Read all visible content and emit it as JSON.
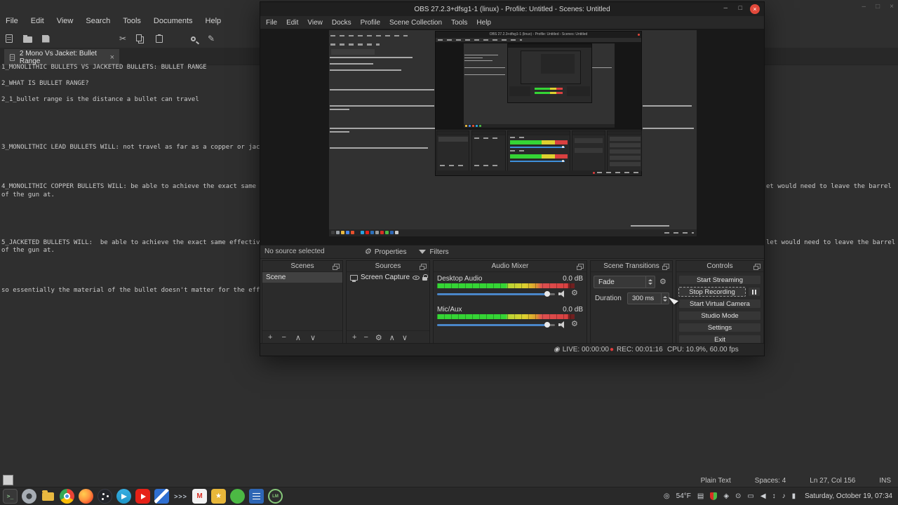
{
  "icons": {
    "close": "×",
    "minimize": "–",
    "maximize": "□",
    "plus": "+",
    "minus": "−",
    "chev_up": "∧",
    "chev_down": "∨",
    "gear": "⚙",
    "live": "◉",
    "record_dot": "●",
    "cut": "✂",
    "replace": "✎",
    "star": "★",
    "chevrons": ">>>",
    "gmail_m": "M",
    "lm": "LM",
    "terminal": ">_",
    "cast": "◎",
    "clipboard": "▤",
    "user": "◈",
    "search_dot": "⊙",
    "display": "▭",
    "volume": "◀",
    "network": "↕",
    "music": "♪",
    "battery": "▮"
  },
  "editor": {
    "menu": [
      "File",
      "Edit",
      "View",
      "Search",
      "Tools",
      "Documents",
      "Help"
    ],
    "tab_title": "2 Mono Vs Jacket: Bullet Range",
    "lines": {
      "l0": "1_MONOLITHIC BULLETS VS JACKETED BULLETS: BULLET RANGE",
      "l1": "2_WHAT IS BULLET RANGE?",
      "l2": "2_1_bullet range is the distance a bullet can travel",
      "l3": "3_MONOLITHIC LEAD BULLETS WILL: not travel as far as a copper or jack",
      "l4": "4_MONOLITHIC COPPER BULLETS WILL: be able to achieve the exact same e",
      "l4r": "et would need to leave the barrel",
      "l4b": "of the gun at.",
      "l5": "5_JACKETED BULLETS WILL:  be able to achieve the exact same effective",
      "l5r": "let would need to leave the barrel",
      "l5b": "of the gun at.",
      "l6": "so essentially the material of the bullet doesn't matter for the effe"
    },
    "status": {
      "language": "Plain Text",
      "spaces": "Spaces: 4",
      "position": "Ln 27, Col 156",
      "mode": "INS"
    }
  },
  "obs": {
    "title": "OBS 27.2.3+dfsg1-1 (linux) - Profile: Untitled - Scenes: Untitled",
    "menu": [
      "File",
      "Edit",
      "View",
      "Docks",
      "Profile",
      "Scene Collection",
      "Tools",
      "Help"
    ],
    "propbar": {
      "status": "No source selected",
      "properties": "Properties",
      "filters": "Filters"
    },
    "scenes": {
      "title": "Scenes",
      "items": [
        "Scene"
      ]
    },
    "sources": {
      "title": "Sources",
      "items": [
        "Screen Capture (X"
      ]
    },
    "mixer": {
      "title": "Audio Mixer",
      "channels": [
        {
          "name": "Desktop Audio",
          "level": "0.0 dB"
        },
        {
          "name": "Mic/Aux",
          "level": "0.0 dB"
        }
      ]
    },
    "transitions": {
      "title": "Scene Transitions",
      "transition": "Fade",
      "duration_label": "Duration",
      "duration_value": "300 ms"
    },
    "controls": {
      "title": "Controls",
      "buttons": [
        "Start Streaming",
        "Stop Recording",
        "Start Virtual Camera",
        "Studio Mode",
        "Settings",
        "Exit"
      ]
    },
    "statusbar": {
      "live": "LIVE: 00:00:00",
      "rec": "REC: 00:01:16",
      "cpu": "CPU: 10.9%, 60.00 fps"
    }
  },
  "taskbar": {
    "tray": {
      "temperature": "54°F",
      "clock": "Saturday, October 19, 07:34"
    }
  }
}
